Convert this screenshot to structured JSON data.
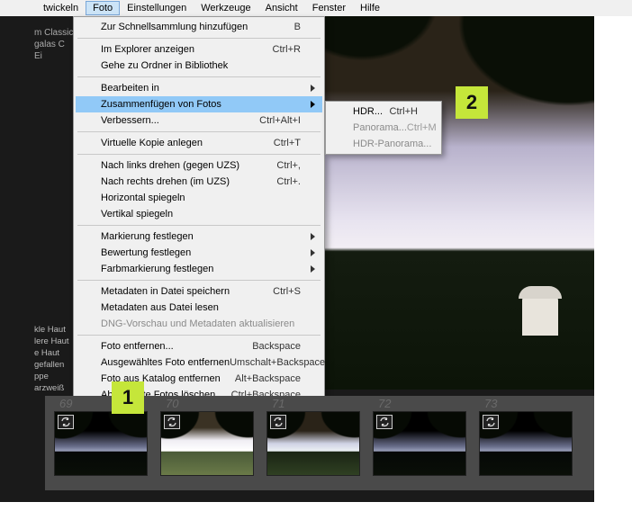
{
  "menubar": {
    "items": [
      "twickeln",
      "Foto",
      "Einstellungen",
      "Werkzeuge",
      "Ansicht",
      "Fenster",
      "Hilfe"
    ],
    "active_index": 1
  },
  "sidebar_fragments": {
    "top": [
      "m Classic",
      "galas C",
      "Ei"
    ],
    "presets": [
      "kle Haut",
      "lere Haut",
      "e Haut",
      "gefallen",
      "ppe",
      "arzweiß"
    ]
  },
  "dropdown": [
    {
      "label": "Zur Schnellsammlung hinzufügen",
      "shortcut": "B"
    },
    {
      "sep": true
    },
    {
      "label": "Im Explorer anzeigen",
      "shortcut": "Ctrl+R"
    },
    {
      "label": "Gehe zu Ordner in Bibliothek"
    },
    {
      "sep": true
    },
    {
      "label": "Bearbeiten in",
      "submenu": true
    },
    {
      "label": "Zusammenfügen von Fotos",
      "submenu": true,
      "highlighted": true
    },
    {
      "label": "Verbessern...",
      "shortcut": "Ctrl+Alt+I"
    },
    {
      "sep": true
    },
    {
      "label": "Virtuelle Kopie anlegen",
      "shortcut": "Ctrl+T"
    },
    {
      "sep": true
    },
    {
      "label": "Nach links drehen (gegen UZS)",
      "shortcut": "Ctrl+,"
    },
    {
      "label": "Nach rechts drehen (im UZS)",
      "shortcut": "Ctrl+."
    },
    {
      "label": "Horizontal spiegeln"
    },
    {
      "label": "Vertikal spiegeln"
    },
    {
      "sep": true
    },
    {
      "label": "Markierung festlegen",
      "submenu": true
    },
    {
      "label": "Bewertung festlegen",
      "submenu": true
    },
    {
      "label": "Farbmarkierung festlegen",
      "submenu": true
    },
    {
      "sep": true
    },
    {
      "label": "Metadaten in Datei speichern",
      "shortcut": "Ctrl+S"
    },
    {
      "label": "Metadaten aus Datei lesen"
    },
    {
      "label": "DNG-Vorschau und Metadaten aktualisieren",
      "disabled": true
    },
    {
      "sep": true
    },
    {
      "label": "Foto entfernen...",
      "shortcut": "Backspace"
    },
    {
      "label": "Ausgewähltes Foto entfernen",
      "shortcut": "Umschalt+Backspace"
    },
    {
      "label": "Foto aus Katalog entfernen",
      "shortcut": "Alt+Backspace"
    },
    {
      "label": "Abgelehnte Fotos löschen...",
      "shortcut": "Ctrl+Backspace"
    }
  ],
  "submenu": [
    {
      "label": "HDR...",
      "shortcut": "Ctrl+H"
    },
    {
      "label": "Panorama...",
      "shortcut": "Ctrl+M",
      "disabled": true
    },
    {
      "label": "HDR-Panorama...",
      "disabled": true
    }
  ],
  "filmstrip": {
    "numbers": [
      "69",
      "70",
      "71",
      "72",
      "73"
    ],
    "variants": [
      "dark",
      "bright",
      "normal",
      "dark",
      "dark"
    ]
  },
  "callouts": {
    "one": "1",
    "two": "2"
  }
}
